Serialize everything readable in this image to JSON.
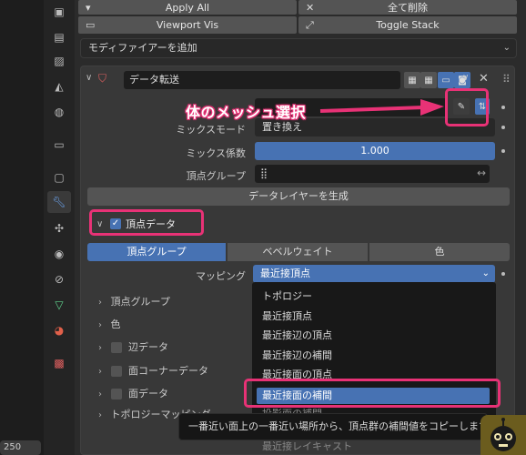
{
  "frame_number": "250",
  "header": {
    "apply_all": "Apply All",
    "delete_all": "全て削除",
    "viewport_vis": "Viewport Vis",
    "toggle_stack": "Toggle Stack"
  },
  "add_modifier": "モディファイアーを追加",
  "modifier": {
    "name": "データ転送",
    "mix_mode_label": "ミックスモード",
    "mix_mode_value": "置き換え",
    "mix_factor_label": "ミックス係数",
    "mix_factor_value": "1.000",
    "vertex_group_label": "頂点グループ",
    "generate_layers": "データレイヤーを生成",
    "vertex_data_label": "頂点データ",
    "vertex_data_checked": true
  },
  "tabs": [
    "頂点グループ",
    "ベベルウェイト",
    "色"
  ],
  "mapping": {
    "label": "マッピング",
    "value": "最近接頂点",
    "options": [
      "トポロジー",
      "最近接頂点",
      "最近接辺の頂点",
      "最近接辺の補間",
      "最近接面の頂点",
      "最近接面の補間",
      "投影面の補間",
      "最近接レイキャスト"
    ],
    "highlighted": "最近接面の補間"
  },
  "subpanels": [
    {
      "label": "頂点グループ",
      "checkbox": false
    },
    {
      "label": "色",
      "checkbox": false
    },
    {
      "label": "辺データ",
      "checkbox": true
    },
    {
      "label": "面コーナーデータ",
      "checkbox": true
    },
    {
      "label": "面データ",
      "checkbox": true
    },
    {
      "label": "トポロジーマッピング",
      "checkbox": false
    }
  ],
  "tooltip": "一番近い面上の一番近い場所から、頂点群の補間値をコピーします",
  "annotation": {
    "callout": "体のメッシュ選択",
    "accent": "#e83276"
  },
  "colors": {
    "blue": "#4772b3",
    "panel": "#383838",
    "highlight": "#e83276"
  }
}
